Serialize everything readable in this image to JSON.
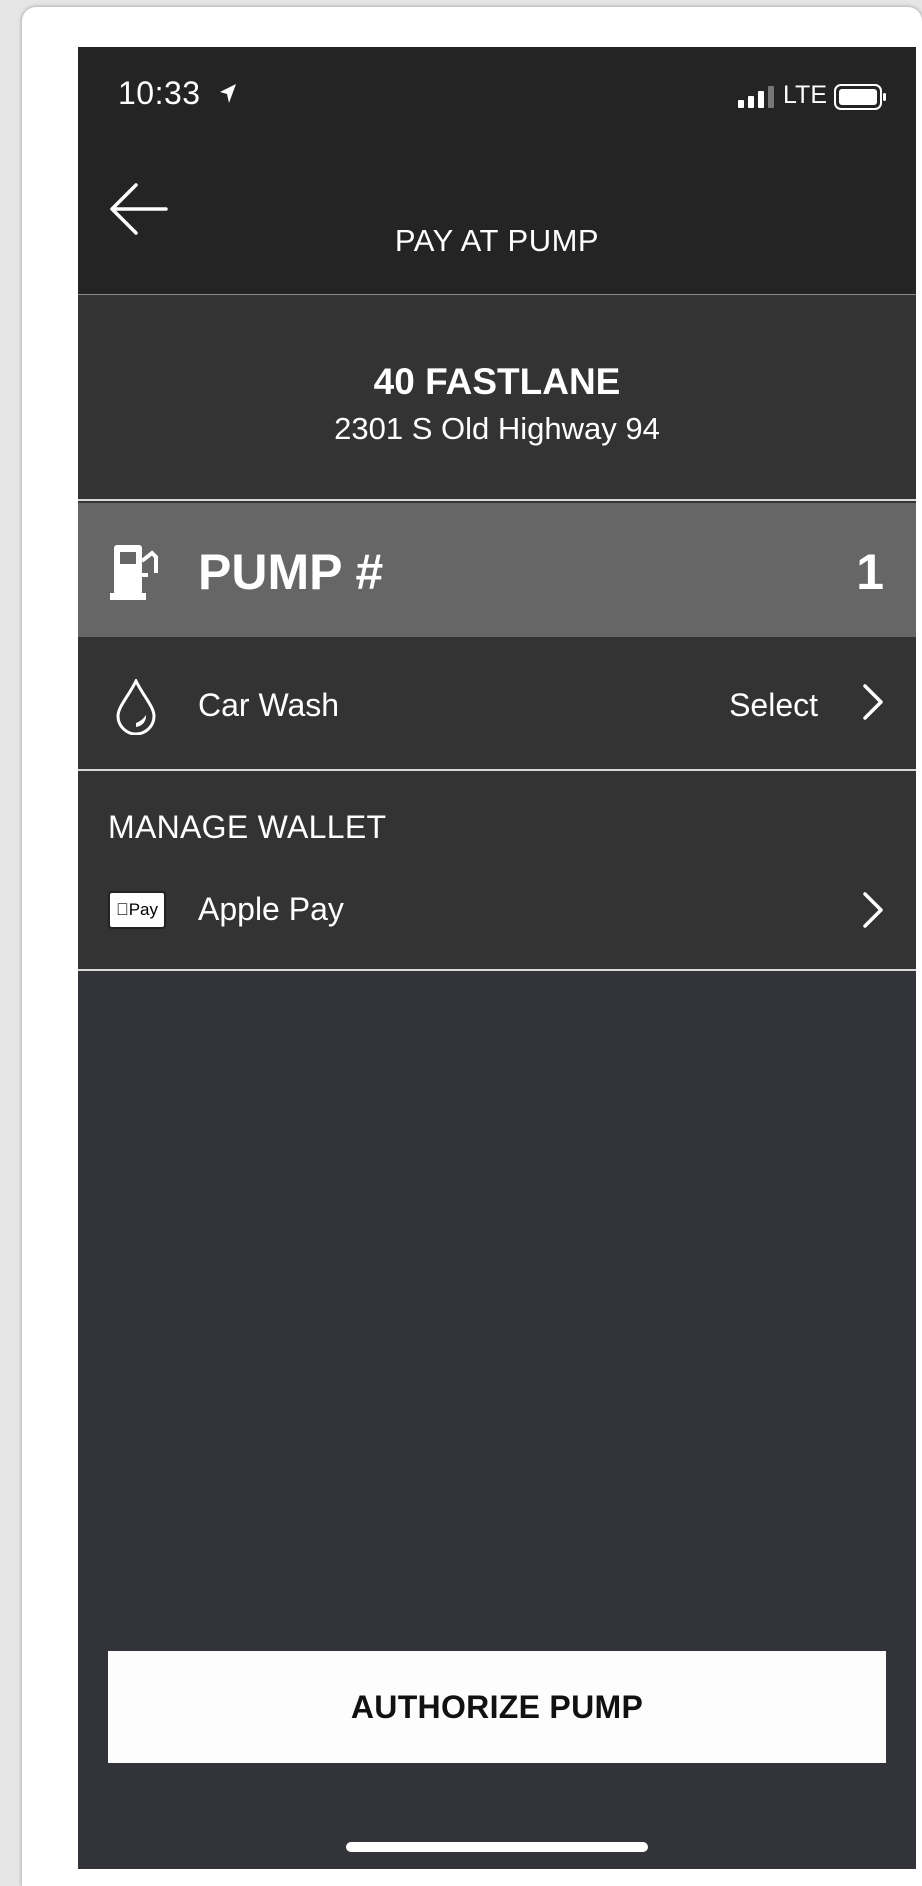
{
  "status_bar": {
    "time": "10:33",
    "network": "LTE",
    "location_icon": "location-arrow-icon",
    "signal_icon": "signal-bars-icon",
    "battery_icon": "battery-icon"
  },
  "nav": {
    "title": "PAY AT PUMP",
    "back_icon": "arrow-left-icon"
  },
  "station": {
    "name": "40 FASTLANE",
    "address": "2301 S Old Highway 94"
  },
  "pump": {
    "label": "PUMP #",
    "number": "1",
    "icon": "fuel-pump-icon"
  },
  "car_wash": {
    "label": "Car Wash",
    "action": "Select",
    "icon": "water-drop-icon"
  },
  "wallet": {
    "header": "MANAGE WALLET",
    "method_label": "Apple Pay",
    "method_badge": "Pay",
    "icon": "apple-pay-icon"
  },
  "footer": {
    "authorize_label": "AUTHORIZE PUMP"
  },
  "colors": {
    "background": "#33333a",
    "header": "#242424",
    "pump_row": "#666666",
    "button": "#fdfdfd"
  }
}
